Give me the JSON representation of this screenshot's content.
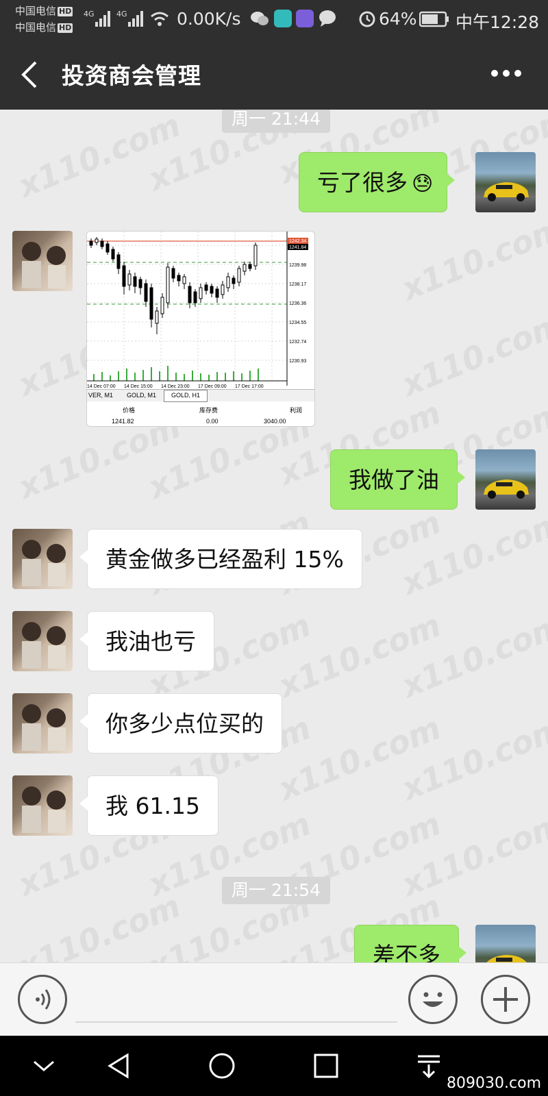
{
  "status_bar": {
    "carrier_1": "中国电信",
    "carrier_2": "中国电信",
    "hd_badge": "HD",
    "network_type_1": "4G",
    "network_type_2": "4G",
    "net_speed": "0.00K/s",
    "battery": "64%",
    "time": "中午12:28"
  },
  "header": {
    "title": "投资商会管理",
    "back_icon": "chevron-left-icon",
    "more_icon": "more-dots-icon",
    "color": "#2f2f2f"
  },
  "messages": [
    {
      "type": "timestamp",
      "text": "周一 21:44"
    },
    {
      "type": "outgoing",
      "text": "亏了很多",
      "emoji": "😓",
      "avatar": "sports-car-avatar"
    },
    {
      "type": "incoming_image",
      "avatar": "girls-piano-avatar"
    },
    {
      "type": "outgoing",
      "text": "我做了油",
      "avatar": "sports-car-avatar"
    },
    {
      "type": "incoming",
      "text": "黄金做多已经盈利 15%",
      "avatar": "girls-piano-avatar"
    },
    {
      "type": "incoming",
      "text": "我油也亏",
      "avatar": "girls-piano-avatar"
    },
    {
      "type": "incoming",
      "text": "你多少点位买的",
      "avatar": "girls-piano-avatar"
    },
    {
      "type": "incoming",
      "text": "我 61.15",
      "avatar": "girls-piano-avatar"
    },
    {
      "type": "timestamp",
      "text": "周一 21:54"
    },
    {
      "type": "outgoing",
      "text": "差不多",
      "avatar": "sports-car-avatar"
    }
  ],
  "chart_image": {
    "price_labels": [
      "1242.34",
      "1241.84",
      "1239.98",
      "1238.17",
      "1236.36",
      "1234.55",
      "1232.74",
      "1230.93"
    ],
    "time_labels": [
      "14 Dec 07:00",
      "14 Dec 15:00",
      "14 Dec 23:00",
      "17 Dec 09:00",
      "17 Dec 17:00"
    ],
    "tabs": [
      "VER, M1",
      "GOLD, M1",
      "GOLD, H1"
    ],
    "table_headers": [
      "价格",
      "库存费",
      "利润"
    ],
    "table_values": [
      "1241.82",
      "0.00",
      "3040.00"
    ]
  },
  "watermark": "x110.com",
  "colors": {
    "outgoing_bubble": "#9eea6a",
    "incoming_bubble": "#ffffff",
    "chat_background": "#ebebeb"
  },
  "input_bar": {
    "voice_icon": "voice-icon",
    "emoji_icon": "emoji-icon",
    "plus_icon": "plus-icon"
  },
  "system_nav": {
    "icons": [
      "chevron-down-icon",
      "back-triangle-icon",
      "home-circle-icon",
      "recents-square-icon",
      "pull-down-icon"
    ]
  },
  "site_watermark": "809030.com"
}
